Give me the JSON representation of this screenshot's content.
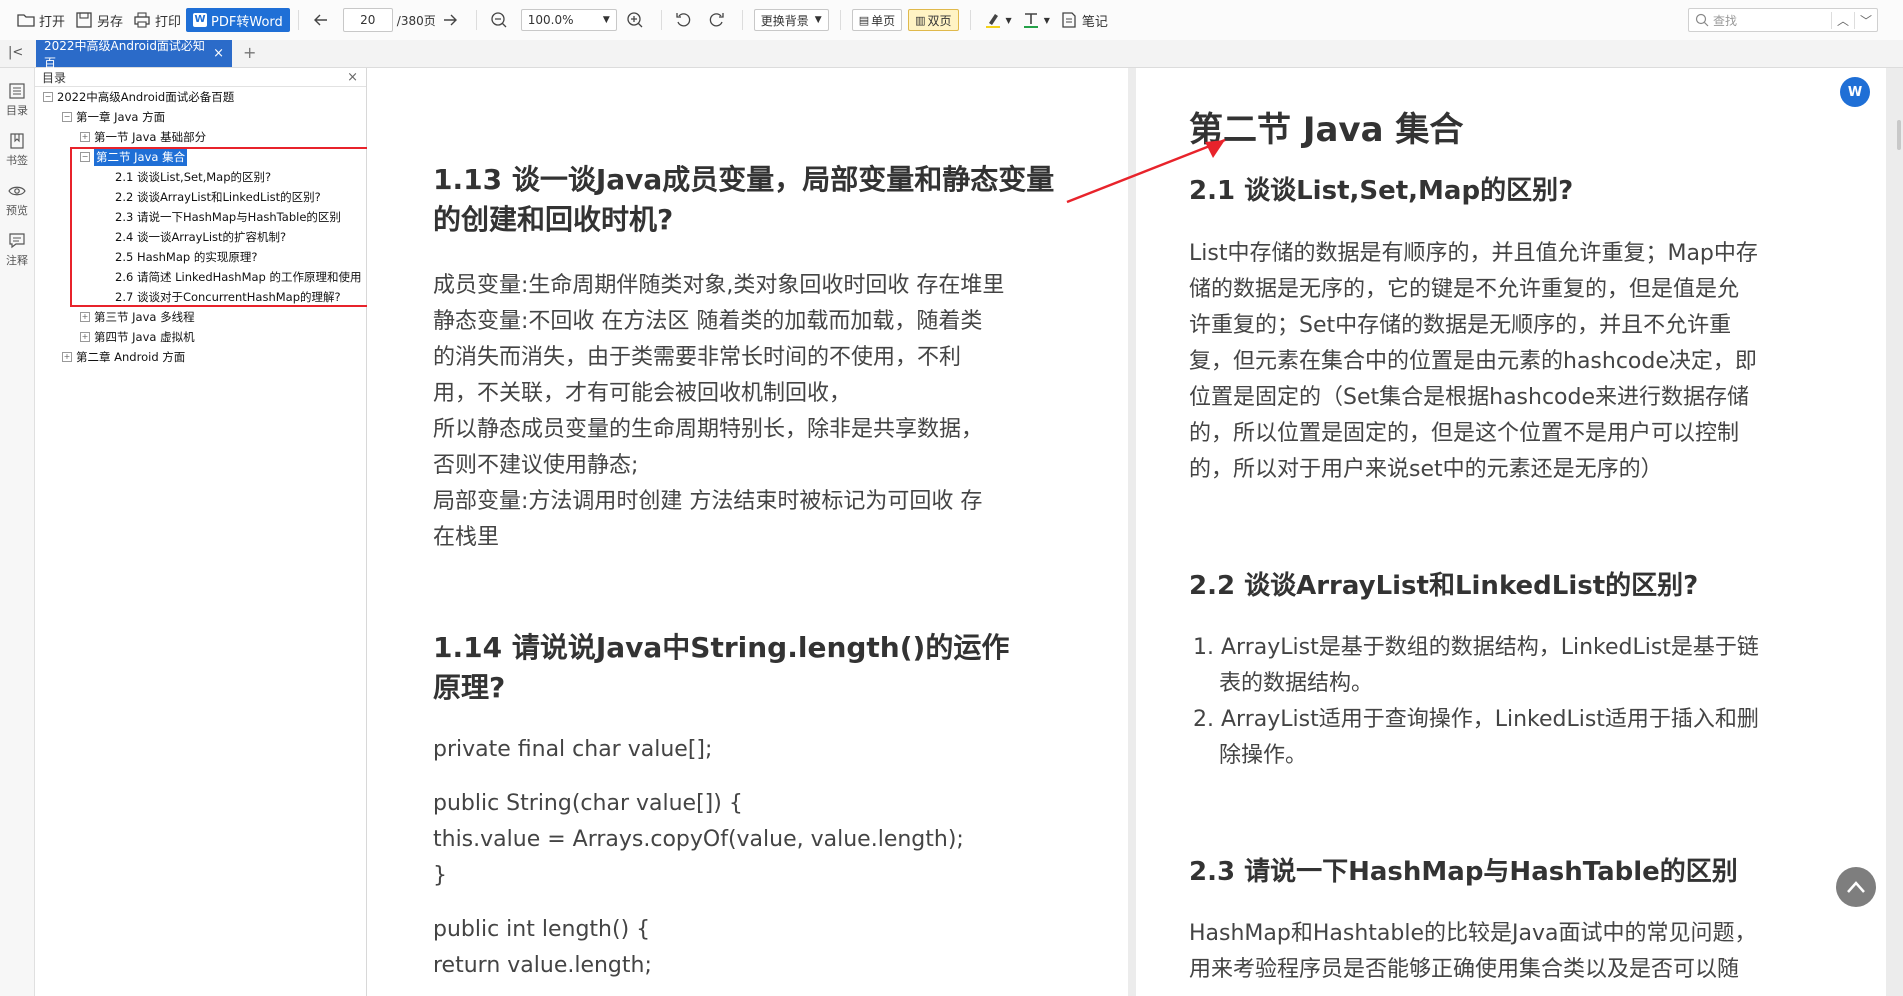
{
  "toolbar": {
    "open": "打开",
    "save_as": "另存",
    "print": "打印",
    "pdf_to_word": "PDF转Word",
    "page_current": "20",
    "page_total": "/380页",
    "zoom": "100.0%",
    "background": "更换背景",
    "single_page": "单页",
    "double_page": "双页",
    "note": "笔记",
    "search_placeholder": "查找"
  },
  "tab": {
    "title": "2022中高级Android面试必知百",
    "close": "×",
    "add": "+"
  },
  "leftbar": {
    "toc": "目录",
    "bookmark": "书签",
    "preview": "预览",
    "annotation": "注释"
  },
  "toc": {
    "header": "目录",
    "close": "×",
    "items": [
      "2022中高级Android面试必备百题",
      "第一章 Java 方面",
      "第一节 Java 基础部分",
      "第二节 Java 集合",
      "2.1 谈谈List,Set,Map的区别?",
      "2.2 谈谈ArrayList和LinkedList的区别?",
      "2.3 请说一下HashMap与HashTable的区别",
      "2.4 谈一谈ArrayList的扩容机制?",
      "2.5 HashMap 的实现原理?",
      "2.6 请简述 LinkedHashMap 的工作原理和使用",
      "2.7 谈谈对于ConcurrentHashMap的理解?",
      "第三节 Java 多线程",
      "第四节 Java 虚拟机",
      "第二章 Android 方面"
    ]
  },
  "left_page": {
    "h1": "1.13 谈一谈Java成员变量，局部变量和静态变量的创建和回收时机?",
    "p1": [
      "成员变量:生命周期伴随类对象,类对象回收时回收 存在堆里",
      "静态变量:不回收 在方法区 随着类的加载而加载，随着类",
      "的消失而消失，由于类需要非常长时间的不使用，不利",
      "用，不关联，才有可能会被回收机制回收，",
      "所以静态成员变量的生命周期特别长，除非是共享数据，",
      "否则不建议使用静态;",
      "局部变量:方法调用时创建 方法结束时被标记为可回收 存",
      "在栈里"
    ],
    "h2": "1.14 请说说Java中String.length()的运作原理?",
    "code1": "private final char value[];",
    "code2": [
      "public String(char value[]) {",
      "this.value = Arrays.copyOf(value, value.length);",
      "}"
    ],
    "code3": [
      "public int length() {",
      "return value.length;"
    ]
  },
  "right_page": {
    "title": "第二节 Java 集合",
    "s21": "2.1 谈谈List,Set,Map的区别?",
    "p21": [
      "List中存储的数据是有顺序的，并且值允许重复；Map中存",
      "储的数据是无序的，它的键是不允许重复的，但是值是允",
      "许重复的；Set中存储的数据是无顺序的，并且不允许重",
      "复，但元素在集合中的位置是由元素的hashcode决定，即",
      "位置是固定的（Set集合是根据hashcode来进行数据存储",
      "的，所以位置是固定的，但是这个位置不是用户可以控制",
      "的，所以对于用户来说set中的元素还是无序的）"
    ],
    "s22": "2.2 谈谈ArrayList和LinkedList的区别?",
    "list22": [
      "1. ArrayList是基于数组的数据结构，LinkedList是基于链",
      "表的数据结构。",
      "2. ArrayList适用于查询操作，LinkedList适用于插入和删",
      "除操作。"
    ],
    "s23": "2.3 请说一下HashMap与HashTable的区别",
    "p23": [
      "HashMap和Hashtable的比较是Java面试中的常见问题，",
      "用来考验程序员是否能够正确使用集合类以及是否可以随"
    ]
  },
  "colors": {
    "accent": "#1f6fd6",
    "red_box": "#e8232b",
    "arrow": "#e8232b"
  }
}
